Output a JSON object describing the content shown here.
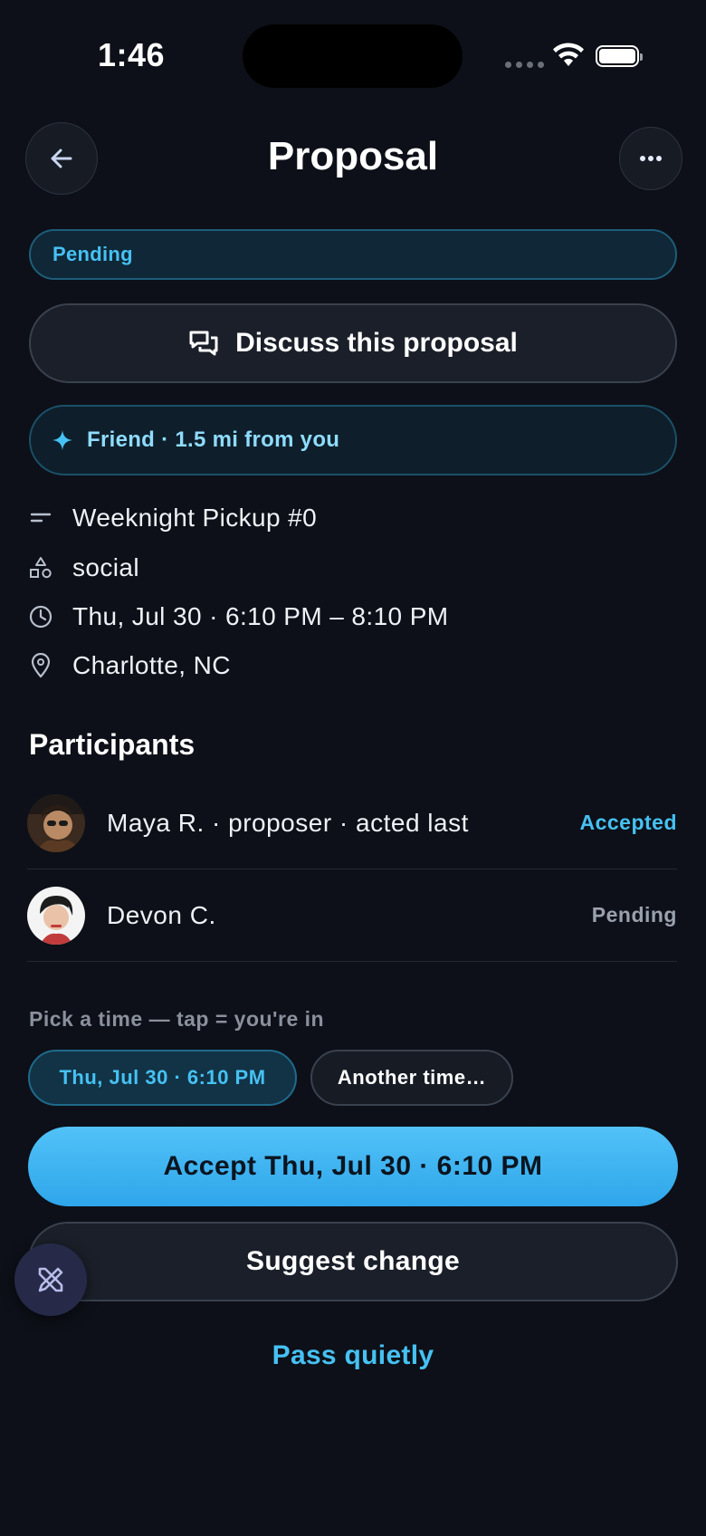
{
  "status_bar": {
    "time": "1:46"
  },
  "header": {
    "title": "Proposal"
  },
  "status_pill": "Pending",
  "discuss_button": "Discuss this proposal",
  "friend_info": "Friend · 1.5 mi from you",
  "details": {
    "name": "Weeknight Pickup #0",
    "category": "social",
    "datetime": "Thu, Jul 30 · 6:10 PM – 8:10 PM",
    "location": "Charlotte, NC"
  },
  "participants": {
    "title": "Participants",
    "items": [
      {
        "name": "Maya R. · proposer · acted last",
        "status": "Accepted"
      },
      {
        "name": "Devon C.",
        "status": "Pending"
      }
    ]
  },
  "time_picker": {
    "label": "Pick a time — tap = you're in",
    "selected_option": "Thu, Jul 30 · 6:10 PM",
    "other_option": "Another time…"
  },
  "actions": {
    "accept": "Accept Thu, Jul 30 · 6:10 PM",
    "suggest": "Suggest change",
    "pass": "Pass quietly"
  },
  "colors": {
    "background": "#0d1018",
    "accent": "#46c1f3",
    "accept_button": "#3fb4f2"
  }
}
